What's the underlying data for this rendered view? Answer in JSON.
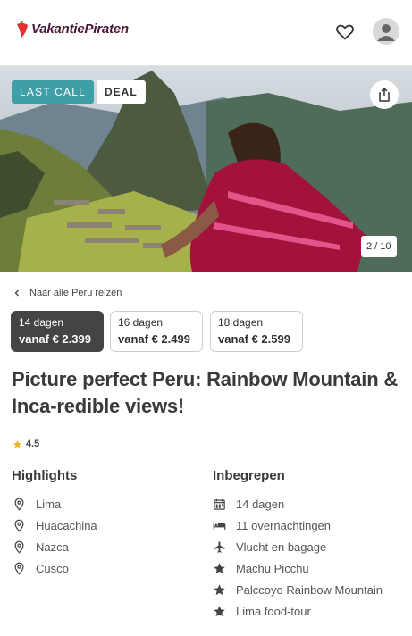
{
  "header": {
    "logo_text": "VakantiePiraten",
    "logo_icon": "pepper-icon",
    "favorite_icon": "heart-icon",
    "account_icon": "user-avatar-icon"
  },
  "hero": {
    "badges": [
      "LAST CALL",
      "DEAL"
    ],
    "share_icon": "share-icon",
    "photo_counter": "2 / 10"
  },
  "breadcrumb": {
    "back_label": "Naar alle Peru reizen"
  },
  "durations": [
    {
      "days": "14 dagen",
      "price": "vanaf € 2.399",
      "selected": true
    },
    {
      "days": "16 dagen",
      "price": "vanaf € 2.499",
      "selected": false
    },
    {
      "days": "18 dagen",
      "price": "vanaf € 2.599",
      "selected": false
    }
  ],
  "trip": {
    "title": "Picture perfect Peru: Rainbow Mountain & Inca-redible views!",
    "rating": "4.5"
  },
  "highlights": {
    "heading": "Highlights",
    "items": [
      "Lima",
      "Huacachina",
      "Nazca",
      "Cusco"
    ]
  },
  "included": {
    "heading": "Inbegrepen",
    "items": [
      {
        "icon": "calendar-icon",
        "label": "14 dagen"
      },
      {
        "icon": "bed-icon",
        "label": "11 overnachtingen"
      },
      {
        "icon": "airplane-icon",
        "label": "Vlucht en bagage"
      },
      {
        "icon": "star-icon",
        "label": "Machu Picchu"
      },
      {
        "icon": "star-icon",
        "label": "Palccoyo Rainbow Mountain"
      },
      {
        "icon": "star-icon",
        "label": "Lima food-tour"
      }
    ]
  },
  "colors": {
    "brand": "#4a1538",
    "teal_badge": "#3f9fa8",
    "selected_pill": "#444444",
    "rating_star": "#f2b01e"
  }
}
